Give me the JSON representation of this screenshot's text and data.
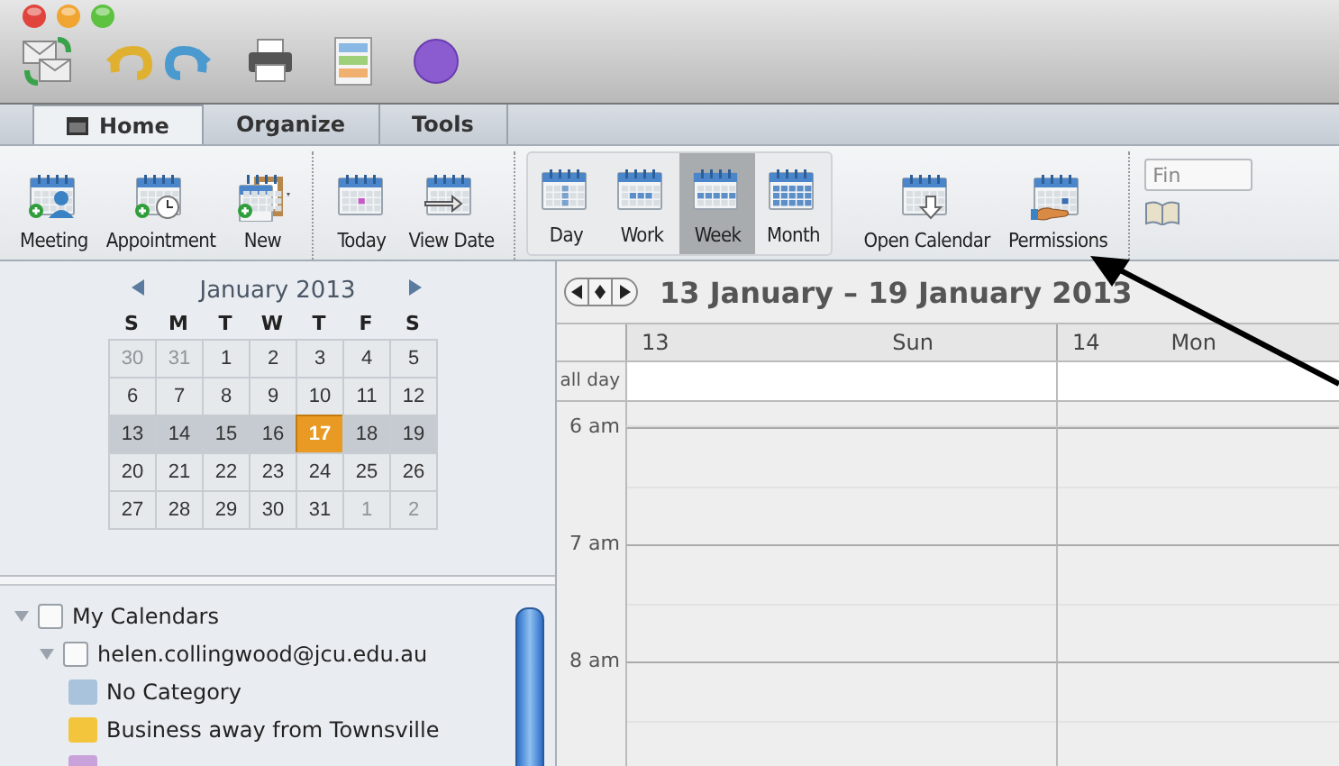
{
  "tabs": [
    {
      "label": "Home",
      "selected": true,
      "kind": "home"
    },
    {
      "label": "Organize",
      "selected": false
    },
    {
      "label": "Tools",
      "selected": false
    }
  ],
  "ribbon": {
    "groups": [
      [
        {
          "label": "Meeting",
          "kind": "meeting",
          "selected": false
        },
        {
          "label": "Appointment",
          "kind": "appointment",
          "selected": false
        },
        {
          "label": "New",
          "kind": "new",
          "selected": false
        }
      ],
      [
        {
          "label": "Today",
          "kind": "today",
          "selected": false
        },
        {
          "label": "View Date",
          "kind": "viewdate",
          "selected": false
        }
      ],
      [
        {
          "label": "Day",
          "kind": "day",
          "selected": false
        },
        {
          "label": "Work",
          "kind": "work",
          "selected": false
        },
        {
          "label": "Week",
          "kind": "week",
          "selected": true
        },
        {
          "label": "Month",
          "kind": "month",
          "selected": false
        }
      ],
      [
        {
          "label": "Open Calendar",
          "kind": "open",
          "selected": false
        },
        {
          "label": "Permissions",
          "kind": "permissions",
          "selected": false
        }
      ]
    ],
    "search": {
      "placeholder": "Fin"
    }
  },
  "mini_calendar": {
    "month": "January 2013",
    "weekdays": [
      "S",
      "M",
      "T",
      "W",
      "T",
      "F",
      "S"
    ],
    "weeks": [
      {
        "selected": false,
        "days": [
          {
            "day": "30",
            "muted": true,
            "today": false
          },
          {
            "day": "31",
            "muted": true,
            "today": false
          },
          {
            "day": "1",
            "muted": false,
            "today": false
          },
          {
            "day": "2",
            "muted": false,
            "today": false
          },
          {
            "day": "3",
            "muted": false,
            "today": false
          },
          {
            "day": "4",
            "muted": false,
            "today": false
          },
          {
            "day": "5",
            "muted": false,
            "today": false
          }
        ]
      },
      {
        "selected": false,
        "days": [
          {
            "day": "6",
            "muted": false,
            "today": false
          },
          {
            "day": "7",
            "muted": false,
            "today": false
          },
          {
            "day": "8",
            "muted": false,
            "today": false
          },
          {
            "day": "9",
            "muted": false,
            "today": false
          },
          {
            "day": "10",
            "muted": false,
            "today": false
          },
          {
            "day": "11",
            "muted": false,
            "today": false
          },
          {
            "day": "12",
            "muted": false,
            "today": false
          }
        ]
      },
      {
        "selected": true,
        "days": [
          {
            "day": "13",
            "muted": false,
            "today": false
          },
          {
            "day": "14",
            "muted": false,
            "today": false
          },
          {
            "day": "15",
            "muted": false,
            "today": false
          },
          {
            "day": "16",
            "muted": false,
            "today": false
          },
          {
            "day": "17",
            "muted": false,
            "today": true
          },
          {
            "day": "18",
            "muted": false,
            "today": false
          },
          {
            "day": "19",
            "muted": false,
            "today": false
          }
        ]
      },
      {
        "selected": false,
        "days": [
          {
            "day": "20",
            "muted": false,
            "today": false
          },
          {
            "day": "21",
            "muted": false,
            "today": false
          },
          {
            "day": "22",
            "muted": false,
            "today": false
          },
          {
            "day": "23",
            "muted": false,
            "today": false
          },
          {
            "day": "24",
            "muted": false,
            "today": false
          },
          {
            "day": "25",
            "muted": false,
            "today": false
          },
          {
            "day": "26",
            "muted": false,
            "today": false
          }
        ]
      },
      {
        "selected": false,
        "days": [
          {
            "day": "27",
            "muted": false,
            "today": false
          },
          {
            "day": "28",
            "muted": false,
            "today": false
          },
          {
            "day": "29",
            "muted": false,
            "today": false
          },
          {
            "day": "30",
            "muted": false,
            "today": false
          },
          {
            "day": "31",
            "muted": false,
            "today": false
          },
          {
            "day": "1",
            "muted": true,
            "today": false
          },
          {
            "day": "2",
            "muted": true,
            "today": false
          }
        ]
      }
    ]
  },
  "calendars": [
    {
      "label": "My Calendars",
      "checked": false,
      "expanded": true,
      "children": [
        {
          "label": "helen.collingwood@jcu.edu.au",
          "checked": false,
          "expanded": true,
          "children": [
            {
              "label": "No Category",
              "color": "#a9c3dc"
            },
            {
              "label": "Business away from Townsville",
              "color": "#f2c53d"
            },
            {
              "color": "#c9a2dc"
            }
          ]
        }
      ]
    }
  ],
  "week_view": {
    "title": "13 January – 19 January 2013",
    "days": [
      {
        "date": "13",
        "name": "Sun"
      },
      {
        "date": "14",
        "name": "Mon"
      }
    ],
    "all_day_label": "all day",
    "hours": [
      "6 am",
      "7 am",
      "8 am"
    ]
  }
}
